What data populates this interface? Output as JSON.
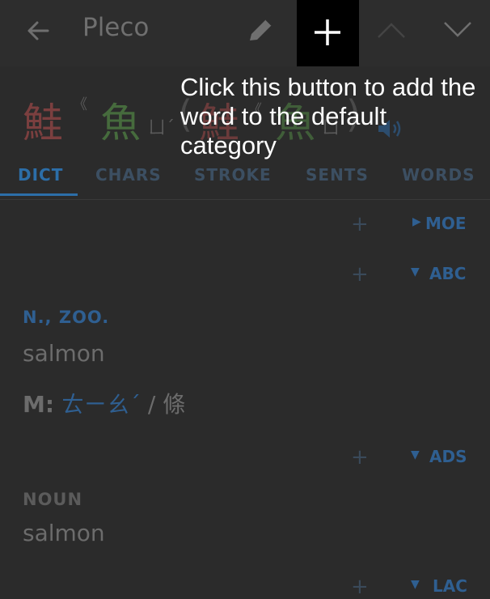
{
  "app": {
    "title": "Pleco"
  },
  "header": {
    "headword_char1": "鮭",
    "headword_marks": "《",
    "headword_char2": "魚",
    "headword_bopomofo": "ㄩˊ",
    "headword_variant_char1": "鮭",
    "headword_variant_mark": "《",
    "headword_variant_char2": "魚",
    "headword_variant_bopomofo": "ㄩ"
  },
  "tabs": [
    "DICT",
    "CHARS",
    "STROKE",
    "SENTS",
    "WORDS"
  ],
  "dictionaries": [
    {
      "add": "+",
      "arrow": "▶",
      "name": "MOE"
    },
    {
      "add": "+",
      "arrow": "▼",
      "name": "ABC"
    },
    {
      "add": "+",
      "arrow": "▼",
      "name": "ADS"
    },
    {
      "add": "+",
      "arrow": "▼",
      "name": "LAC"
    }
  ],
  "abc": {
    "pos": "N., ZOO.",
    "definition": "salmon",
    "measure_label": "M:",
    "measure_bopomofo": "ㄊㄧㄠˊ",
    "measure_sep": "/",
    "measure_char": "條"
  },
  "ads": {
    "pos": "NOUN",
    "definition": "salmon"
  },
  "tooltip": {
    "text": "Click this button to add the word to the default category"
  },
  "icons": {
    "back": "arrow-left-icon",
    "edit": "pencil-icon",
    "add": "plus-icon",
    "up": "chevron-up-icon",
    "down": "chevron-down-icon",
    "audio": "speaker-icon"
  },
  "colors": {
    "background": "#2b2b2b",
    "accent": "#2c6ea8",
    "tone_red": "#7b3f3f",
    "tone_green": "#466b3d",
    "tooltip_button": "#000000"
  }
}
